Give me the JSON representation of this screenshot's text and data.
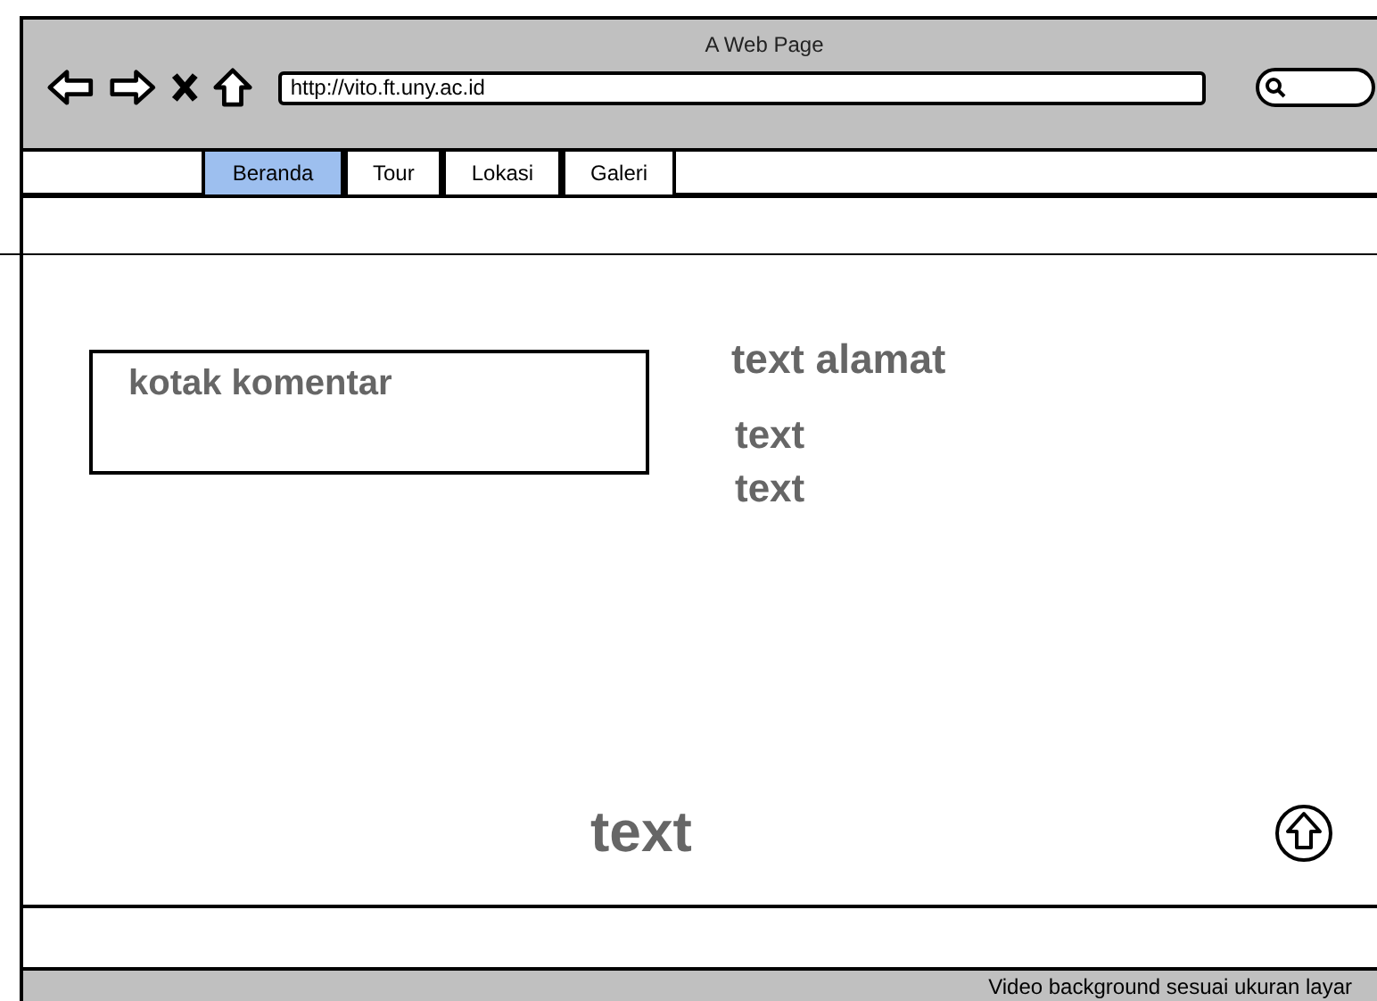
{
  "window": {
    "title": "A Web Page"
  },
  "address_bar": {
    "value": "http://vito.ft.uny.ac.id"
  },
  "tabs": [
    {
      "label": "Beranda",
      "selected": true
    },
    {
      "label": "Tour",
      "selected": false
    },
    {
      "label": "Lokasi",
      "selected": false
    },
    {
      "label": "Galeri",
      "selected": false
    }
  ],
  "comment_box": {
    "label": "kotak komentar"
  },
  "address_text": "text alamat",
  "info_lines": [
    "text",
    "text"
  ],
  "footer_text": "text",
  "status_bar": "Video background sesuai ukuran layar"
}
